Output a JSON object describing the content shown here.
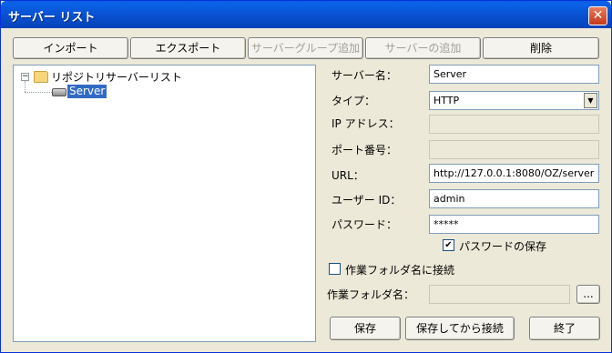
{
  "window": {
    "title": "サーバー リスト",
    "close_glyph": "✕"
  },
  "toolbar": {
    "import_label": "インポート",
    "export_label": "エクスポート",
    "add_group_label": "サーバーグループ追加",
    "add_server_label": "サーバーの追加",
    "delete_label": "削除"
  },
  "tree": {
    "expander_glyph": "−",
    "root_label": "リポジトリサーバーリスト",
    "child_label": "Server"
  },
  "form": {
    "server_name_label": "サーバー名：",
    "server_name_value": "Server",
    "type_label": "タイプ：",
    "type_value": "HTTP",
    "ip_label": "IP アドレス：",
    "port_label": "ポート番号：",
    "url_label": "URL：",
    "url_value": "http://127.0.0.1:8080/OZ/server",
    "user_id_label": "ユーザー ID：",
    "user_id_value": "admin",
    "password_label": "パスワード：",
    "password_value": "*****",
    "save_password_label": "パスワードの保存",
    "save_password_checked": true,
    "connect_workfolder_label": "作業フォルダ名に接続",
    "connect_workfolder_checked": false,
    "workfolder_label": "作業フォルダ名：",
    "browse_label": "..."
  },
  "footer": {
    "save_label": "保存",
    "save_connect_label": "保存してから接続",
    "exit_label": "終了"
  },
  "icons": {
    "checkmark": "✔",
    "dropdown_arrow": "▼"
  }
}
